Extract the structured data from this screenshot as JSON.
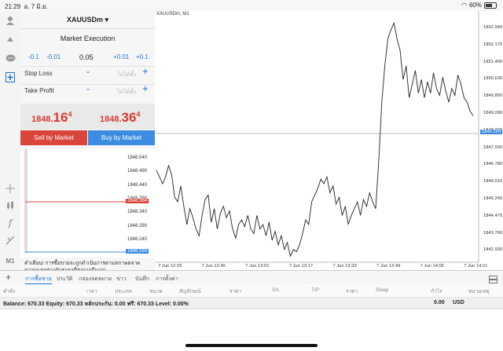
{
  "status": {
    "time": "21:29",
    "date": "อ. 7 มิ.ย.",
    "battery": "60%"
  },
  "panel": {
    "symbol": "XAUUSDm",
    "symbol_arrow": "▾",
    "execution": "Market Execution",
    "steps": {
      "m1": "-0.1",
      "m2": "-0.01",
      "volume": "0.05",
      "p1": "+0.01",
      "p2": "+0.1"
    },
    "stop_loss": {
      "label": "Stop Loss",
      "minus": "-",
      "value": "ไม่ได้ตั้ง",
      "plus": "+"
    },
    "take_profit": {
      "label": "Take Profit",
      "minus": "-",
      "value": "ไม่ได้ตั้ง",
      "plus": "+"
    },
    "bid": {
      "small": "1848.",
      "big": "16",
      "sup": "4"
    },
    "ask": {
      "small": "1848.",
      "big": "36",
      "sup": "4"
    },
    "sell_label": "Sell by Market",
    "buy_label": "Buy by Market",
    "mini_ticks": [
      "1848.540",
      "1848.490",
      "1848.440",
      "1848.390",
      "1848.340",
      "1848.290",
      "1848.240",
      "1848.190"
    ],
    "mini_ask_label": "1848.364",
    "mini_bid_label": "1848.164",
    "warning": "คำเตือน! การซื้อขายจะถูกดำเนินการตามสภาพตลาด ความแตกต่างกับราคาที่ส่งอาจมีมาก!"
  },
  "chart": {
    "title": "XAUUSDm, M1",
    "current_price_label": "1849.164",
    "colors": {
      "line": "#222222",
      "bid_line": "#3c8de2"
    }
  },
  "chart_data": {
    "type": "line",
    "x": [
      "7 Jun 12:29",
      "7 Jun 12:45",
      "7 Jun 13:01",
      "7 Jun 13:17",
      "7 Jun 13:33",
      "7 Jun 13:49",
      "7 Jun 14:05",
      "7 Jun 14:21"
    ],
    "y_ticks": [
      "1852.940",
      "1852.170",
      "1851.400",
      "1850.630",
      "1849.860",
      "1849.090",
      "1848.320",
      "1847.550",
      "1846.780",
      "1846.010",
      "1845.240",
      "1844.470",
      "1843.700",
      "1842.930"
    ],
    "ylim": [
      1842.6,
      1853.35
    ],
    "values": [
      1846.6,
      1846.3,
      1846.0,
      1846.3,
      1846.8,
      1846.4,
      1845.4,
      1845.2,
      1845.9,
      1845.0,
      1844.2,
      1844.9,
      1844.5,
      1844.0,
      1843.7,
      1844.6,
      1845.3,
      1845.5,
      1844.3,
      1844.9,
      1844.0,
      1844.7,
      1845.0,
      1844.5,
      1844.8,
      1844.0,
      1843.6,
      1844.2,
      1844.4,
      1844.1,
      1844.6,
      1844.0,
      1843.8,
      1844.6,
      1844.0,
      1844.2,
      1843.7,
      1844.3,
      1843.5,
      1843.9,
      1843.3,
      1843.7,
      1843.1,
      1843.4,
      1842.8,
      1843.1,
      1843.0,
      1843.3,
      1843.8,
      1844.4,
      1844.2,
      1845.2,
      1845.5,
      1845.8,
      1846.2,
      1846.0,
      1846.3,
      1845.6,
      1845.9,
      1845.1,
      1845.4,
      1844.6,
      1845.0,
      1844.2,
      1844.6,
      1844.9,
      1845.2,
      1844.6,
      1845.3,
      1845.0,
      1845.6,
      1845.2,
      1844.9,
      1847.0,
      1849.6,
      1851.2,
      1852.4,
      1852.8,
      1853.1,
      1852.4,
      1851.9,
      1850.6,
      1851.2,
      1849.8,
      1850.4,
      1851.0,
      1850.0,
      1850.6,
      1849.8,
      1850.5,
      1850.0,
      1850.9,
      1850.2,
      1849.9,
      1850.7,
      1850.1,
      1849.6,
      1850.2,
      1849.9,
      1850.8,
      1850.4,
      1849.8,
      1849.6,
      1849.2,
      1849.0
    ]
  },
  "tabs": [
    "การซื้อขาย",
    "ประวัติ",
    "กล่องจดหมาย",
    "ข่าว",
    "บันทึก",
    "การตั้งค่า"
  ],
  "columns": [
    "คำสั่ง",
    "เวลา",
    "ประเภท",
    "ขนาด",
    "สัญลักษณ์",
    "ราคา",
    "S/L",
    "T/P",
    "ราคา",
    "Swap",
    "กำไร",
    "หมายเหตุ"
  ],
  "balance": {
    "text": "Balance: 670.33 Equity: 670.33 หลักประกัน: 0.00 ฟรี: 670.33 Level: 0.00%",
    "a": "0.00",
    "b": "USD"
  }
}
